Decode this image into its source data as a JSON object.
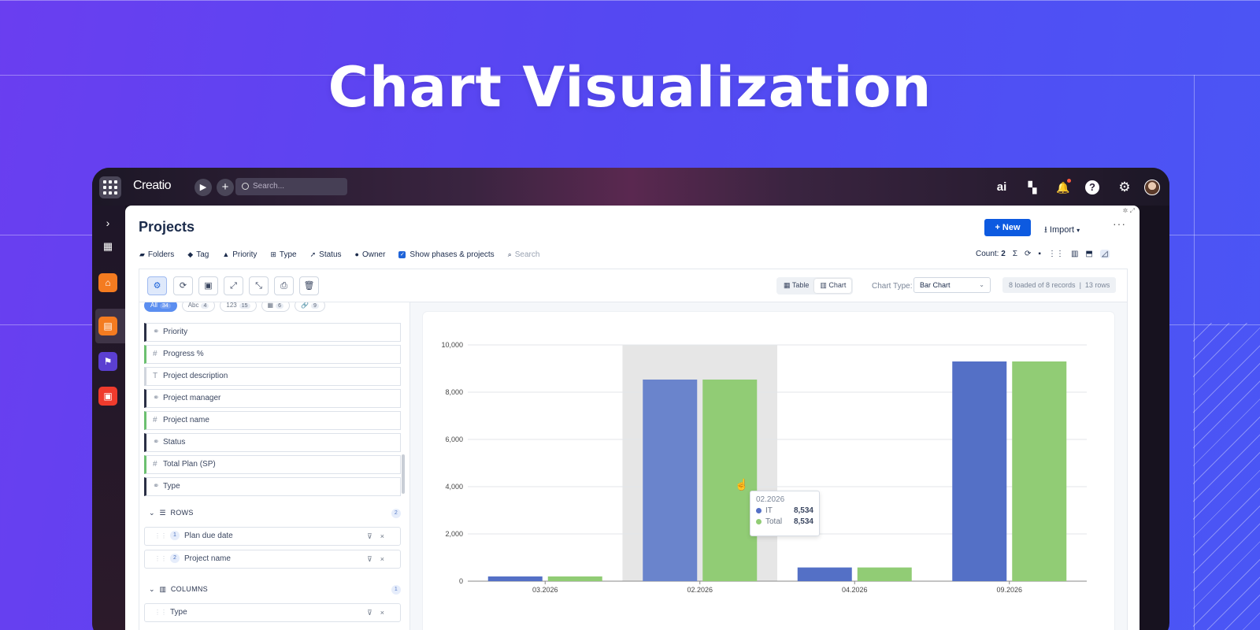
{
  "hero": {
    "title": "Chart Visualization"
  },
  "topbar": {
    "logo": "Creatio",
    "search_placeholder": "Search...",
    "ai_label": "ai"
  },
  "page": {
    "title": "Projects",
    "new_button": "New",
    "import_button": "Import"
  },
  "filters": [
    {
      "icon": "folder-icon",
      "label": "Folders"
    },
    {
      "icon": "tag-icon",
      "label": "Tag"
    },
    {
      "icon": "warning-icon",
      "label": "Priority"
    },
    {
      "icon": "type-icon",
      "label": "Type"
    },
    {
      "icon": "rocket-icon",
      "label": "Status"
    },
    {
      "icon": "user-icon",
      "label": "Owner"
    }
  ],
  "show_phases": {
    "label": "Show phases & projects",
    "checked": true
  },
  "filter_search": "Search",
  "count": {
    "label": "Count:",
    "value": "2"
  },
  "view": {
    "table": "Table",
    "chart": "Chart",
    "selected": "Chart"
  },
  "chart_type": {
    "label": "Chart Type:",
    "value": "Bar Chart"
  },
  "records": {
    "loaded": "8 loaded of 8 records",
    "rows": "13 rows"
  },
  "chips": [
    {
      "label": "All",
      "count": "34",
      "active": true
    },
    {
      "label": "Abc",
      "count": "4"
    },
    {
      "label": "123",
      "count": "15"
    },
    {
      "label": "▦",
      "count": "6"
    },
    {
      "label": "🔗",
      "count": "9"
    }
  ],
  "fields": [
    {
      "type": "link",
      "label": "Priority"
    },
    {
      "type": "num",
      "label": "Progress %"
    },
    {
      "type": "text",
      "label": "Project description"
    },
    {
      "type": "link",
      "label": "Project manager"
    },
    {
      "type": "num",
      "label": "Project name"
    },
    {
      "type": "link",
      "label": "Status"
    },
    {
      "type": "num",
      "label": "Total Plan (SP)"
    },
    {
      "type": "link",
      "label": "Type"
    }
  ],
  "rows_section": {
    "title": "ROWS",
    "count": "2",
    "items": [
      {
        "idx": "1",
        "label": "Plan due date"
      },
      {
        "idx": "2",
        "label": "Project name"
      }
    ]
  },
  "columns_section": {
    "title": "COLUMNS",
    "count": "1",
    "items": [
      {
        "label": "Type"
      }
    ]
  },
  "tooltip": {
    "title": "02.2026",
    "rows": [
      {
        "name": "IT",
        "value": "8,534",
        "color": "#5470c6"
      },
      {
        "name": "Total",
        "value": "8,534",
        "color": "#91cc75"
      }
    ]
  },
  "chart_data": {
    "type": "bar",
    "categories": [
      "03.2026",
      "02.2026",
      "04.2026",
      "09.2026"
    ],
    "series": [
      {
        "name": "IT",
        "color": "#5470c6",
        "values": [
          200,
          8534,
          580,
          9300
        ]
      },
      {
        "name": "Total",
        "color": "#91cc75",
        "values": [
          200,
          8534,
          580,
          9300
        ]
      }
    ],
    "ylim": [
      0,
      10000
    ],
    "yticks": [
      "0",
      "2,000",
      "4,000",
      "6,000",
      "8,000",
      "10,000"
    ],
    "highlighted_category": "02.2026"
  }
}
